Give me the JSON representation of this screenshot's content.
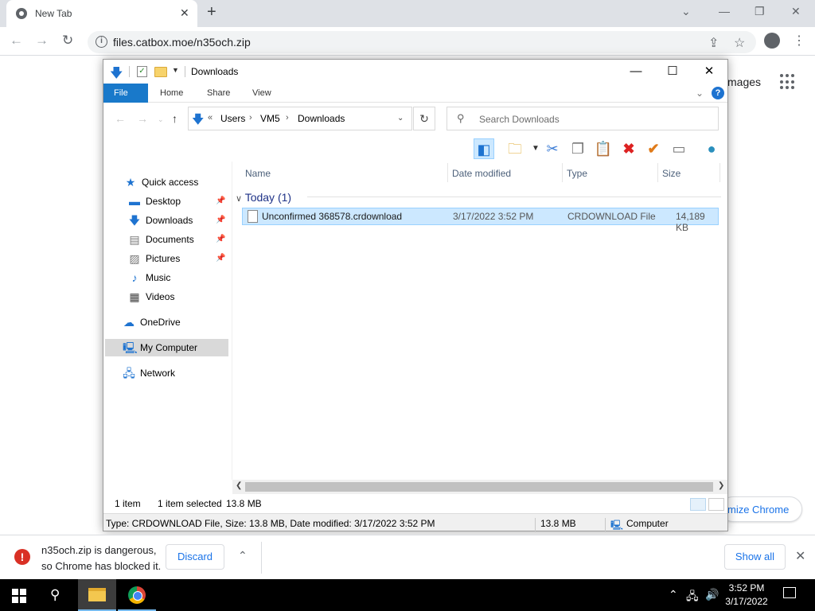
{
  "browser": {
    "tab_title": "New Tab",
    "url": "files.catbox.moe/n35och.zip",
    "page_images_text": "mages",
    "customize_text": "mize Chrome"
  },
  "explorer": {
    "window_title": "Downloads",
    "ribbon_tabs": [
      "File",
      "Home",
      "Share",
      "View"
    ],
    "breadcrumb": [
      "Users",
      "VM5",
      "Downloads"
    ],
    "breadcrumb_prefix": "«",
    "search_placeholder": "Search Downloads",
    "nav": {
      "quick_access": "Quick access",
      "desktop": "Desktop",
      "downloads": "Downloads",
      "documents": "Documents",
      "pictures": "Pictures",
      "music": "Music",
      "videos": "Videos",
      "onedrive": "OneDrive",
      "my_computer": "My Computer",
      "network": "Network"
    },
    "columns": [
      "Name",
      "Date modified",
      "Type",
      "Size"
    ],
    "group": "Today (1)",
    "file": {
      "name": "Unconfirmed 368578.crdownload",
      "date": "3/17/2022 3:52 PM",
      "type": "CRDOWNLOAD File",
      "size": "14,189 KB"
    },
    "status": {
      "count": "1 item",
      "selected": "1 item selected",
      "selected_size": "13.8 MB",
      "detail": "Type: CRDOWNLOAD File, Size: 13.8 MB, Date modified: 3/17/2022 3:52 PM",
      "detail_size": "13.8 MB",
      "location": "Computer"
    }
  },
  "download_shelf": {
    "msg_line1": "n35och.zip is dangerous,",
    "msg_line2": "so Chrome has blocked it.",
    "discard": "Discard",
    "show_all": "Show all"
  },
  "taskbar": {
    "time": "3:52 PM",
    "date": "3/17/2022"
  },
  "colors": {
    "accent": "#1979ca",
    "selection": "#cce8ff",
    "danger": "#d93025",
    "chrome_link": "#1a73e8"
  }
}
